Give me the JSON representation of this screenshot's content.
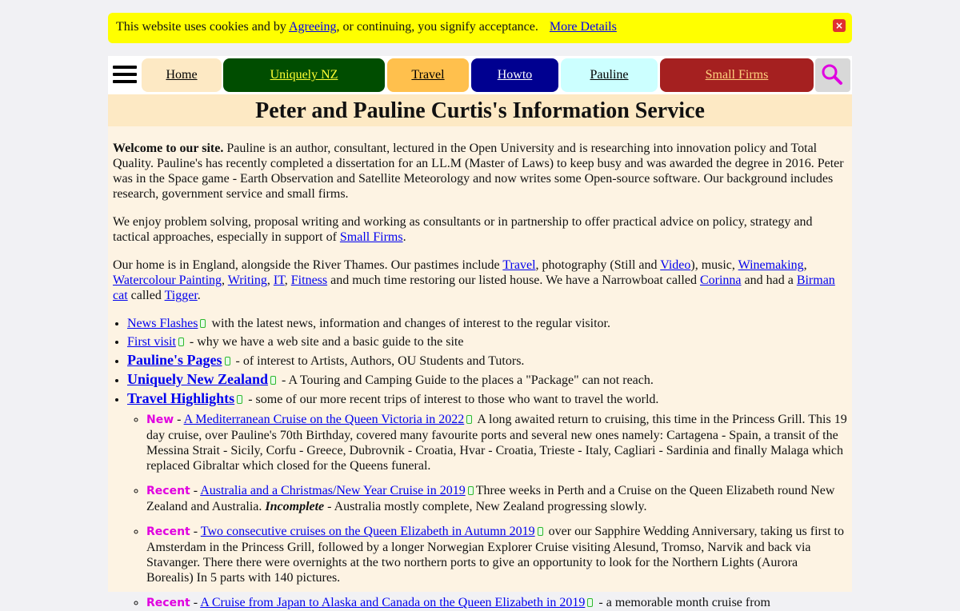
{
  "cookie": {
    "text_before": "This website uses cookies and by ",
    "agree_link": "Agreeing",
    "text_after": ", or continuing, you signify acceptance.",
    "more_link": "More Details",
    "close_glyph": "×"
  },
  "nav": {
    "items": [
      {
        "label": "Home",
        "bg": "#fde9c4",
        "color": "#000000"
      },
      {
        "label": "Uniquely NZ",
        "bg": "#004d00",
        "color": "#ffff33"
      },
      {
        "label": "Travel",
        "bg": "#ffc04d",
        "color": "#000000"
      },
      {
        "label": "Howto",
        "bg": "#000090",
        "color": "#ffffff"
      },
      {
        "label": "Pauline",
        "bg": "#ccffff",
        "color": "#000000"
      },
      {
        "label": "Small Firms",
        "bg": "#a52020",
        "color": "#ffd27f"
      }
    ],
    "search_icon_color": "#e000e0"
  },
  "header": {
    "title": "Peter and Pauline Curtis's Information Service"
  },
  "intro": {
    "welcome_bold": "Welcome to our site.",
    "welcome_text": " Pauline is an author, consultant, lectured in the Open University and is researching into innovation policy and Total Quality. Pauline's has recently completed a dissertation for an LL.M (Master of Laws) to keep busy and was awarded the degree in 2016. Peter was in the Space game - Earth Observation and Satellite Meteorology and now writes some Open-source software. Our background includes research, government service and small firms.",
    "p2_text": "We enjoy problem solving, proposal writing and working as consultants or in partnership to offer practical advice on policy, strategy and tactical approaches, especially in support of ",
    "p2_link": "Small Firms",
    "p2_end": ".",
    "p3_a": "Our home is in England, alongside the River Thames. Our pastimes include ",
    "p3_travel": "Travel",
    "p3_b": ", photography (Still and ",
    "p3_video": "Video",
    "p3_c": "), music, ",
    "p3_wine": "Winemaking",
    "p3_d": ", ",
    "p3_water": "Watercolour Painting",
    "p3_e": ", ",
    "p3_writing": "Writing",
    "p3_f": ", ",
    "p3_it": "IT",
    "p3_g": ", ",
    "p3_fitness": "Fitness",
    "p3_h": " and much time restoring our listed house. We have a Narrowboat called ",
    "p3_corinna": "Corinna",
    "p3_i": " and had a ",
    "p3_birman": "Birman cat",
    "p3_j": " called ",
    "p3_tigger": "Tigger",
    "p3_k": "."
  },
  "list": {
    "news_link": "News Flashes",
    "news_text": " with the latest news, information and changes of interest to the regular visitor.",
    "first_link": "First visit",
    "first_text": " - why we have a web site and a basic guide to the site",
    "pauline_link": "Pauline's Pages",
    "pauline_text": " - of interest to Artists, Authors, OU Students and Tutors.",
    "nz_link": "Uniquely New Zealand",
    "nz_text": " - A Touring and Camping Guide to the places a \"Package\" can not reach.",
    "travel_link": "Travel Highlights",
    "travel_text": " - some of our more recent trips of interest to those who want to travel the world."
  },
  "trips": [
    {
      "tag": "New",
      "sep": " - ",
      "link": "A Mediterranean Cruise on the Queen Victoria in 2022",
      "text": " A long awaited return to cruising, this time in the Princess Grill. This 19 day cruise, over Pauline's 70th Birthday, covered many favourite ports and several new ones namely: Cartagena - Spain, a transit of the Messina Strait - Sicily, Corfu - Greece, Dubrovnik - Croatia, Hvar - Croatia, Trieste - Italy, Cagliari - Sardinia and finally Malaga which replaced Gibraltar which closed for the Queens funeral.",
      "italic": "",
      "tail": ""
    },
    {
      "tag": "Recent",
      "sep": " - ",
      "link": "Australia and a Christmas/New Year Cruise in 2019",
      "text": "Three weeks in Perth and a Cruise on the Queen Elizabeth round New Zealand and Australia. ",
      "italic": "Incomplete",
      "tail": " - Australia mostly complete, New Zealand progressing slowly."
    },
    {
      "tag": "Recent",
      "sep": " - ",
      "link": "Two consecutive cruises on the Queen Elizabeth in Autumn 2019",
      "text": " over our Sapphire Wedding Anniversary, taking us first to Amsterdam in the Princess Grill, followed by a longer Norwegian Explorer Cruise visiting Alesund, Tromso, Narvik and back via Stavanger. There there were overnights at the two northern ports to give an opportunity to look for the Northern Lights (Aurora Borealis) In 5 parts with 140 pictures.",
      "italic": "",
      "tail": ""
    },
    {
      "tag": "Recent",
      "sep": " - ",
      "link": "A Cruise from Japan to Alaska and Canada on the Queen Elizabeth in 2019",
      "text": " - a memorable month cruise from",
      "italic": "",
      "tail": ""
    }
  ]
}
